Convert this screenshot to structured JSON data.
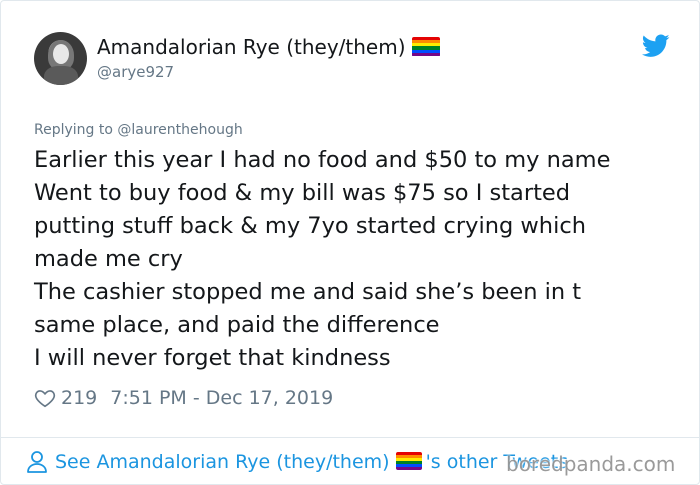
{
  "author": {
    "display_name": "Amandalorian Rye (they/them)",
    "handle": "@arye927"
  },
  "flag_colors": [
    "#e40303",
    "#ff8c00",
    "#ffed00",
    "#008026",
    "#004dff",
    "#750787"
  ],
  "brand_color": "#1da1f2",
  "link_color": "#1b95e0",
  "reply": {
    "text": "Replying to @laurenthehough"
  },
  "tweet": {
    "lines": [
      "Earlier this year I had no food and $50 to my name",
      "Went to buy food & my bill was $75 so I started",
      "putting stuff back & my 7yo started crying which",
      "made me cry",
      "The cashier stopped me and said she’s been in t",
      "same place, and paid the difference",
      "I will never forget that kindness"
    ]
  },
  "meta": {
    "likes": "219",
    "timestamp": "7:51 PM - Dec 17, 2019"
  },
  "footer": {
    "prefix": "See Amandalorian Rye (they/them)",
    "suffix": "'s other Tweets"
  },
  "watermark": "boredpanda.com",
  "icons": {
    "bird": "twitter-bird-icon",
    "heart": "heart-icon",
    "user": "user-icon"
  }
}
